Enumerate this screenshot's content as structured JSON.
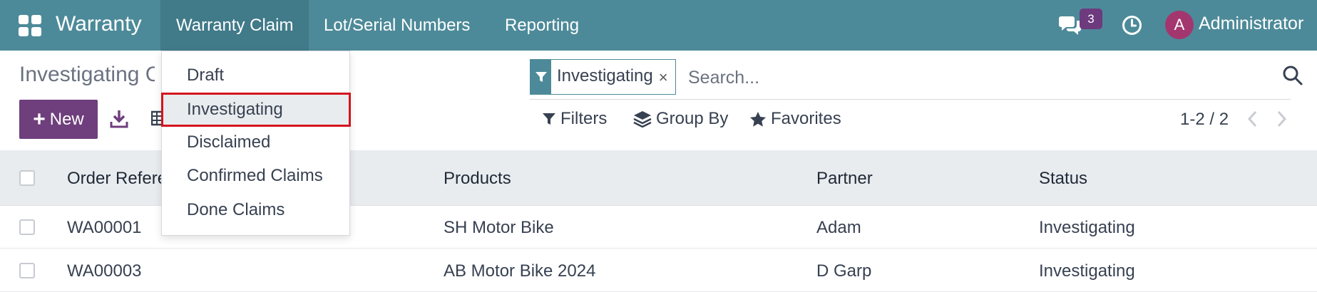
{
  "navbar": {
    "app_title": "Warranty",
    "menu": [
      "Warranty Claim",
      "Lot/Serial Numbers",
      "Reporting"
    ],
    "chat_badge": "3",
    "avatar_initial": "A",
    "user_name": "Administrator",
    "color": "#4d8a99"
  },
  "control_panel": {
    "breadcrumb": "Investigating Claims",
    "new_label": "New",
    "facet": "Investigating",
    "facet_close": "×",
    "search_placeholder": "Search...",
    "filters_label": "Filters",
    "group_by_label": "Group By",
    "favorites_label": "Favorites",
    "pager": "1-2 / 2"
  },
  "dropdown": {
    "items": [
      "Draft",
      "Investigating",
      "Disclaimed",
      "Confirmed Claims",
      "Done Claims"
    ],
    "selected": "Investigating"
  },
  "table": {
    "columns": [
      "Order Reference",
      "Products",
      "Partner",
      "Status"
    ],
    "rows": [
      {
        "order": "WA00001",
        "product": "SH Motor Bike",
        "partner": "Adam",
        "status": "Investigating"
      },
      {
        "order": "WA00003",
        "product": "AB Motor Bike 2024",
        "partner": "D Garp",
        "status": "Investigating"
      }
    ]
  },
  "colors": {
    "primary": "#6f3e7c",
    "highlight": "#d4141c"
  }
}
